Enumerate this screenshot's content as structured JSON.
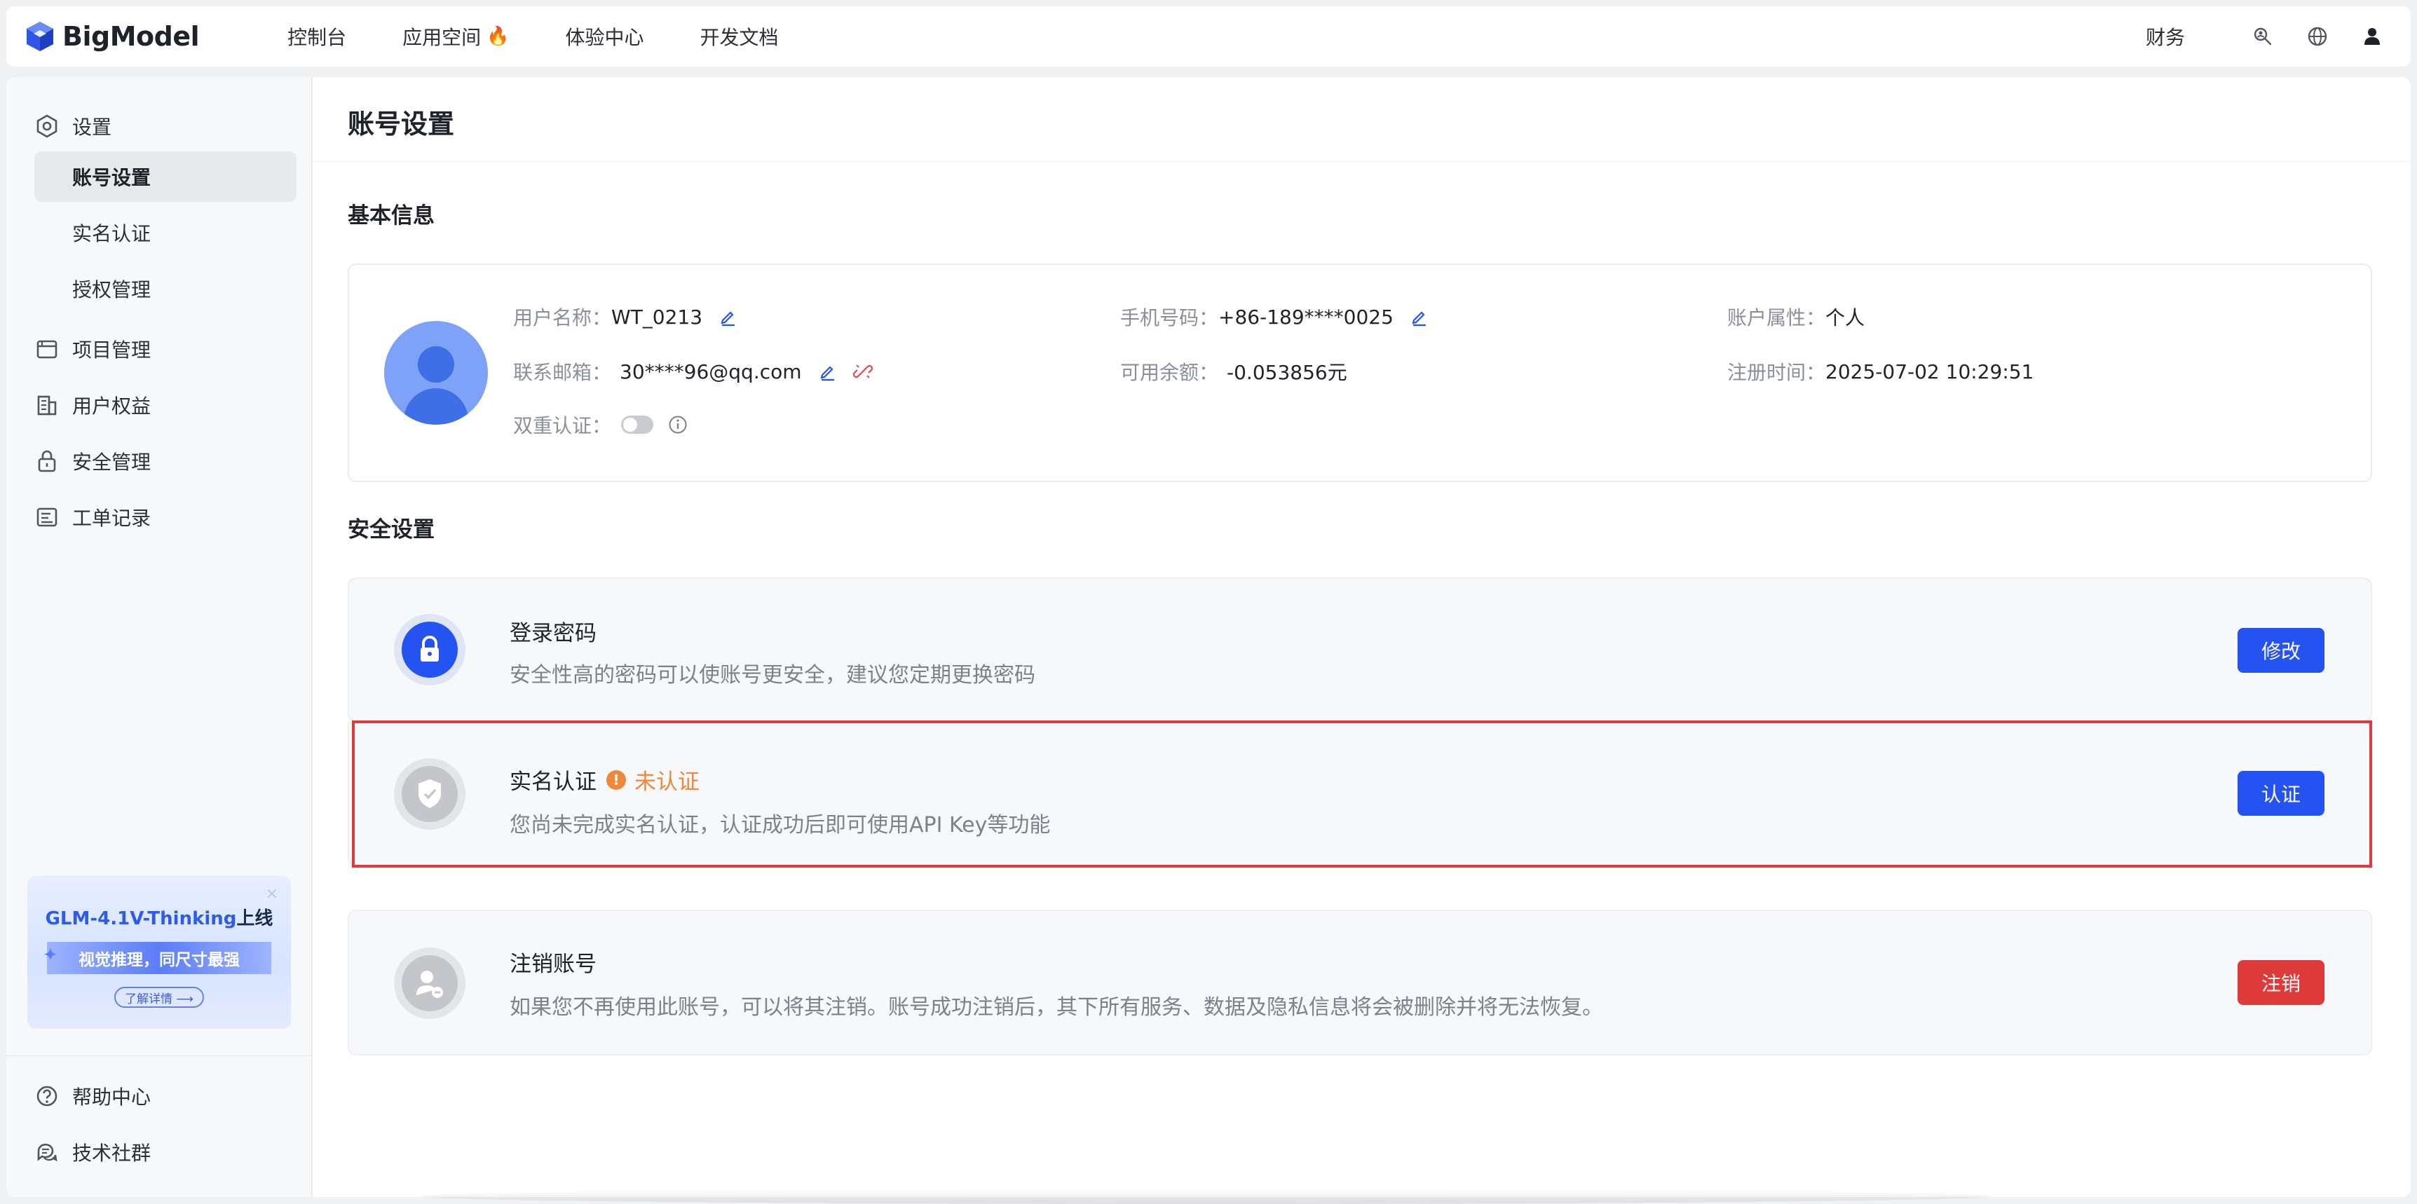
{
  "app": {
    "logo_text": "BigModel"
  },
  "nav": {
    "items": [
      {
        "label": "控制台"
      },
      {
        "label": "应用空间",
        "badge": "🔥"
      },
      {
        "label": "体验中心"
      },
      {
        "label": "开发文档"
      }
    ],
    "finance": "财务",
    "icons": [
      "search-person-icon",
      "globe-icon",
      "user-icon"
    ]
  },
  "sidebar": {
    "settings": "设置",
    "sub": [
      "账号设置",
      "实名认证",
      "授权管理"
    ],
    "groups": [
      "项目管理",
      "用户权益",
      "安全管理",
      "工单记录"
    ],
    "promo": {
      "title_hl": "GLM-4.1V-Thinking",
      "title_rest": "上线",
      "band": "视觉推理，同尺寸最强",
      "button": "了解详情 ⟶"
    },
    "footer": [
      "帮助中心",
      "技术社群"
    ]
  },
  "main": {
    "title": "账号设置",
    "basic_info_title": "基本信息",
    "basic": {
      "username_label": "用户名称：",
      "username": "WT_0213",
      "email_label": "联系邮箱：",
      "email": "30****96@qq.com",
      "two_factor_label": "双重认证：",
      "phone_label": "手机号码：",
      "phone": "+86-189****0025",
      "balance_label": "可用余额：",
      "balance": "-0.053856元",
      "account_type_label": "账户属性：",
      "account_type": "个人",
      "register_label": "注册时间：",
      "register_time": "2025-07-02 10:29:51"
    },
    "security_title": "安全设置",
    "security": {
      "password": {
        "name": "登录密码",
        "desc": "安全性高的密码可以使账号更安全，建议您定期更换密码",
        "button": "修改"
      },
      "realname": {
        "name": "实名认证",
        "status": "未认证",
        "desc": "您尚未完成实名认证，认证成功后即可使用API Key等功能",
        "button": "认证"
      },
      "cancel": {
        "name": "注销账号",
        "desc": "如果您不再使用此账号，可以将其注销。账号成功注销后，其下所有服务、数据及隐私信息将会被删除并将无法恢复。",
        "button": "注销"
      }
    }
  },
  "colors": {
    "primary": "#2453f2",
    "danger": "#de3a3a",
    "warning": "#f0883a",
    "highlight": "#e23a3a"
  }
}
